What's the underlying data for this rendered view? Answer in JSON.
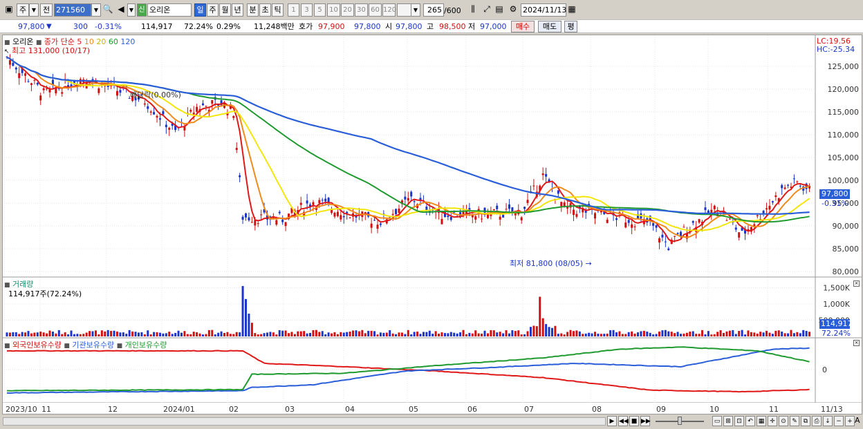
{
  "toolbar": {
    "period_day": "주",
    "prev_label": "전",
    "stock_code": "271560",
    "badge_new": "신",
    "stock_name": "오리온",
    "tabs": [
      "일",
      "주",
      "월",
      "년",
      "분",
      "초",
      "틱"
    ],
    "intervals": [
      "1",
      "3",
      "5",
      "10",
      "20",
      "30",
      "60",
      "120"
    ],
    "count": "265",
    "count_total": "/600",
    "date": "2024/11/13"
  },
  "info": {
    "price": "97,800",
    "change": "300",
    "change_pct": "-0.31%",
    "volume": "114,917",
    "vol_ratio": "72.24%",
    "turnover_pct": "0.29%",
    "amount": "11,248백만",
    "bid_label": "호가",
    "bid": "97,900",
    "ask": "97,800",
    "open_label": "시",
    "open": "97,800",
    "high_label": "고",
    "high": "98,500",
    "low_label": "저",
    "low": "97,000",
    "buy_label": "매수",
    "sell_label": "매도",
    "eval_label": "평"
  },
  "price_pane": {
    "stock_name": "오리온",
    "ma_label": "종가 단순",
    "ma_periods": [
      "5",
      "10",
      "20",
      "60",
      "120"
    ],
    "high_note": "최고 131,000 (10/17)",
    "low_note": "최저 81,800 (08/05)",
    "dividend_note": "배당락(0.00%)",
    "lc_label": "LC:19.56",
    "hc_label": "HC:-25.34",
    "current_tag": "97,800",
    "current_pct": "-0.31%",
    "y_ticks": [
      "125,000",
      "120,000",
      "115,000",
      "110,000",
      "105,000",
      "100,000",
      "95,000",
      "90,000",
      "85,000",
      "80,000"
    ]
  },
  "volume_pane": {
    "title": "거래량",
    "value": "114,917주(72.24%)",
    "y_ticks": [
      "1,500K",
      "1,000K",
      "500,000"
    ],
    "tag": "114,917",
    "tag_pct": "72.24%"
  },
  "holding_pane": {
    "legend": [
      "외국인보유수량",
      "기관보유수량",
      "개인보유수량"
    ],
    "y_tick": "0"
  },
  "x_axis": [
    "2023/10",
    "11",
    "12",
    "2024/01",
    "02",
    "03",
    "04",
    "05",
    "06",
    "07",
    "08",
    "09",
    "10",
    "11"
  ],
  "x_axis_right": "11/13",
  "colors": {
    "up": "#d01010",
    "down": "#1a35c8",
    "ma5": "#e01818",
    "ma10": "#f08a1a",
    "ma20": "#f2e60a",
    "ma60": "#1f9a2f",
    "ma120": "#2a5ed8"
  },
  "chart_data": {
    "type": "candlestick",
    "title": "오리온",
    "y_range": [
      80000,
      131000
    ],
    "ma_series": [
      {
        "name": "5"
      },
      {
        "name": "10"
      },
      {
        "name": "20"
      },
      {
        "name": "60"
      },
      {
        "name": "120"
      }
    ],
    "last_price": 97800,
    "high": {
      "value": 131000,
      "date": "10/17"
    },
    "low": {
      "value": 81800,
      "date": "08/05"
    }
  }
}
